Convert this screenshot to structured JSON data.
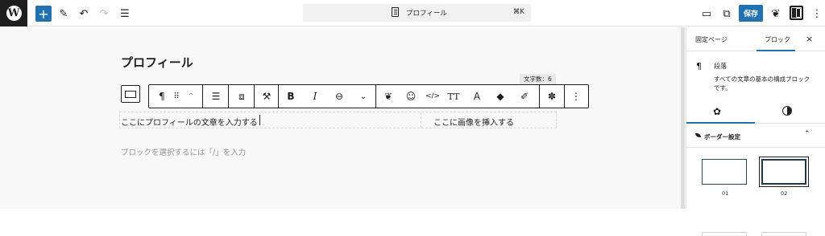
{
  "topbar": {
    "document_title": "プロフィール",
    "shortcut": "⌘K",
    "save_label": "保存",
    "icons": [
      "wordpress-logo",
      "add-block-icon",
      "pencil-icon",
      "undo-icon",
      "redo-icon",
      "list-view-icon",
      "desktop-preview-icon",
      "external-link-icon",
      "leaf-icon",
      "sidebar-toggle-icon",
      "more-vertical-icon"
    ]
  },
  "editor": {
    "page_title": "プロフィール",
    "char_count": "文字数：6",
    "paragraph_text": "ここにプロフィールの文章を入力する",
    "image_text": "ここに画像を挿入する",
    "placeholder": "ブロックを選択するには「/」を入力"
  },
  "block_toolbar": {
    "labels": {
      "paragraph": "¶",
      "drag": "⠿",
      "move": "⌃",
      "align": "☰",
      "bold": "B",
      "italic": "I",
      "link": "⊖",
      "more_rich": "⌄",
      "emoji": "☺",
      "code": "</>",
      "text_size": "TT",
      "font": "A",
      "options": "⋮"
    }
  },
  "sidebar": {
    "tab_page": "固定ページ",
    "tab_block": "ブロック",
    "close": "×",
    "block_icon": "¶",
    "block_name": "段落",
    "block_description": "すべての文章の基本の構成ブロックです。",
    "settings_icon": "✿",
    "panel_title": "ボーダー設定",
    "panel_chevron": "⌃",
    "style_options": [
      "01",
      "02"
    ]
  }
}
